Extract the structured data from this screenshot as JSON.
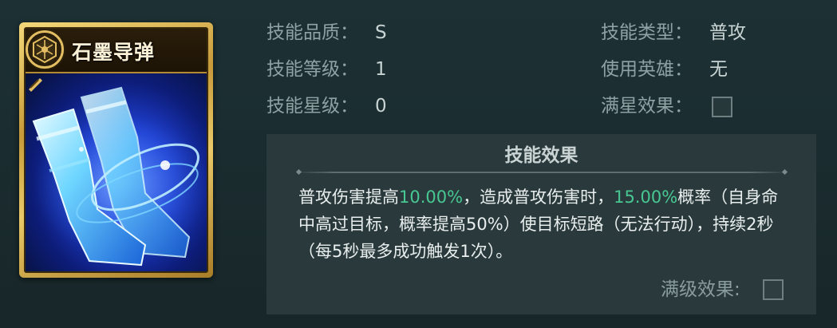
{
  "card": {
    "title": "石墨导弹",
    "emblem_icon": "hex-flower-emblem-icon",
    "art_icon": "blue-boots-art-icon",
    "corner_icon": "gold-corner-badge-icon",
    "accent_gold": "#e2bd62",
    "art_blue": "#1f3fd1"
  },
  "info": {
    "quality_label": "技能品质：",
    "quality_value": "S",
    "level_label": "技能等级：",
    "level_value": "1",
    "star_label": "技能星级：",
    "star_value": "0",
    "type_label": "技能类型：",
    "type_value": "普攻",
    "hero_label": "使用英雄：",
    "hero_value": "无",
    "fullstar_label": "满星效果：",
    "fullstar_checked": false
  },
  "effect": {
    "title": "技能效果",
    "seg1": "普攻伤害提高",
    "val1": "10.00%",
    "seg2": "，造成普攻伤害时，",
    "val2": "15.00%",
    "seg3": "概率（自身命中高过目标，概率提高50%）使目标短路（无法行动），持续2秒（每5秒最多成功触发1次）。",
    "highlight_color": "#47c792",
    "maxlevel_label": "满级效果:",
    "maxlevel_checked": false
  }
}
